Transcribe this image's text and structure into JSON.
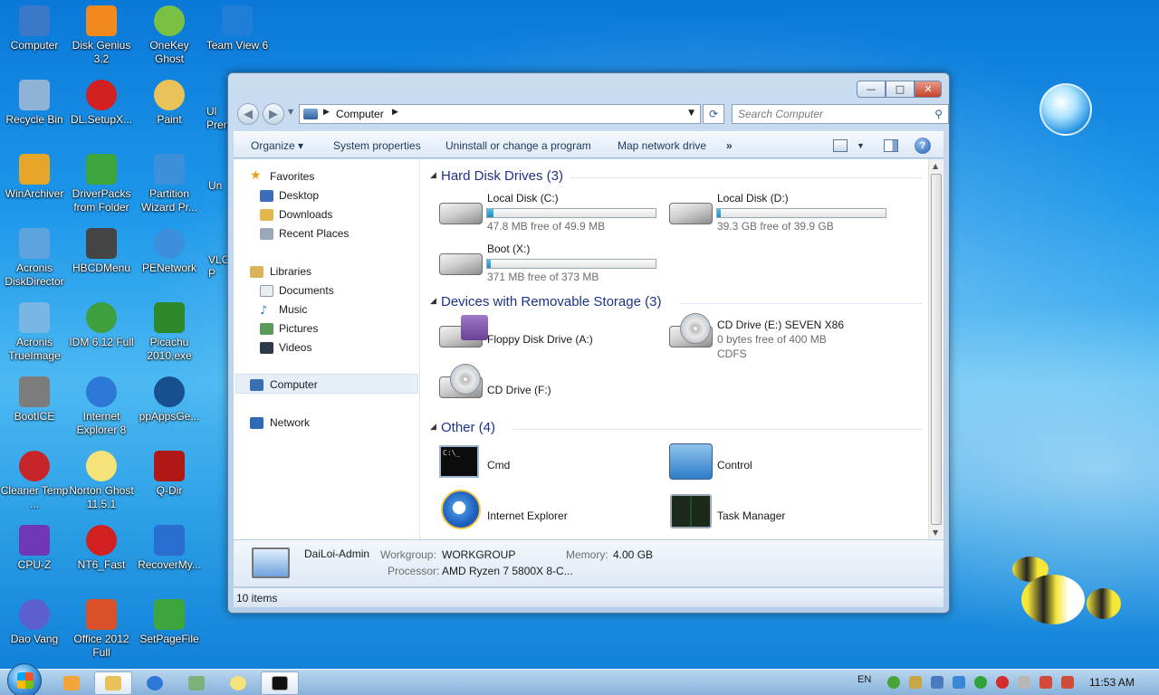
{
  "desktop": {
    "icons": [
      {
        "label": "Computer",
        "color": "#3a78c8"
      },
      {
        "label": "Disk Genius 3.2",
        "color": "#f08a1c"
      },
      {
        "label": "OneKey Ghost",
        "color": "#7ac043"
      },
      {
        "label": "Team View 6",
        "color": "#1f7fd6"
      },
      {
        "label": "Recycle Bin",
        "color": "#8fb3d6"
      },
      {
        "label": "DL.SetupX...",
        "color": "#d21f1f"
      },
      {
        "label": "Paint",
        "color": "#e9c25a"
      },
      {
        "label": "WinArchiver",
        "color": "#e6a629"
      },
      {
        "label": "DriverPacks from Folder",
        "color": "#3da53b"
      },
      {
        "label": "Partition Wizard Pr...",
        "color": "#3c8fd8"
      },
      {
        "label": "Acronis DiskDirector",
        "color": "#5da4df"
      },
      {
        "label": "HBCDMenu",
        "color": "#444444"
      },
      {
        "label": "PENetwork",
        "color": "#3d8edb"
      },
      {
        "label": "Acronis TrueImage",
        "color": "#79b6e6"
      },
      {
        "label": "IDM 6.12 Full",
        "color": "#3da03c"
      },
      {
        "label": "Picachu 2010.exe",
        "color": "#2c8a2c"
      },
      {
        "label": "BootICE",
        "color": "#7c7c7c"
      },
      {
        "label": "Internet Explorer 8",
        "color": "#2d78d6"
      },
      {
        "label": "ppAppsGe...",
        "color": "#17508f"
      },
      {
        "label": "Cleaner Temp ...",
        "color": "#c6262a"
      },
      {
        "label": "Norton Ghost 11.5.1",
        "color": "#f6e27a"
      },
      {
        "label": "Q-Dir",
        "color": "#b01818"
      },
      {
        "label": "CPU-Z",
        "color": "#7038b8"
      },
      {
        "label": "NT6_Fast",
        "color": "#d21f1f"
      },
      {
        "label": "RecoverMy...",
        "color": "#2a6fd0"
      },
      {
        "label": "Dao Vang",
        "color": "#5d5fcf"
      },
      {
        "label": "Office 2012 Full",
        "color": "#d8512a"
      },
      {
        "label": "SetPageFile",
        "color": "#3da53b"
      }
    ],
    "partial_labels": [
      "Ul",
      "Pren",
      "Un",
      "VLC",
      "P"
    ]
  },
  "window": {
    "controls": {
      "minimize": "—",
      "maximize": "□",
      "close": "✕"
    },
    "address": {
      "location": "Computer",
      "icon": "computer-icon"
    },
    "search": {
      "placeholder": "Search Computer"
    },
    "toolbar": {
      "organize": "Organize ▾",
      "system_properties": "System properties",
      "uninstall": "Uninstall or change a program",
      "map_drive": "Map network drive",
      "more": "»"
    },
    "nav": {
      "favorites": "Favorites",
      "desktop": "Desktop",
      "downloads": "Downloads",
      "recent": "Recent Places",
      "libraries": "Libraries",
      "documents": "Documents",
      "music": "Music",
      "pictures": "Pictures",
      "videos": "Videos",
      "computer": "Computer",
      "network": "Network"
    },
    "groups": {
      "hdd": "Hard Disk Drives (3)",
      "removable": "Devices with Removable Storage (3)",
      "other": "Other (4)"
    },
    "drives": {
      "c": {
        "name": "Local Disk (C:)",
        "free": "47.8 MB free of 49.9 MB",
        "used_fraction": 0.04
      },
      "d": {
        "name": "Local Disk (D:)",
        "free": "39.3 GB free of 39.9 GB",
        "used_fraction": 0.015
      },
      "x": {
        "name": "Boot (X:)",
        "free": "371 MB free of 373 MB",
        "used_fraction": 0.005
      }
    },
    "removable": {
      "floppy": "Floppy Disk Drive (A:)",
      "cd_e": {
        "name": "CD Drive (E:) SEVEN X86",
        "free": "0 bytes free of 400 MB",
        "fs": "CDFS"
      },
      "cd_f": "CD Drive (F:)"
    },
    "other": {
      "cmd": "Cmd",
      "control": "Control",
      "ie": "Internet Explorer",
      "taskmgr": "Task Manager"
    },
    "details": {
      "name": "DaiLoi-Admin",
      "workgroup_label": "Workgroup:",
      "workgroup": "WORKGROUP",
      "memory_label": "Memory:",
      "memory": "4.00 GB",
      "processor_label": "Processor:",
      "processor": "AMD Ryzen 7 5800X 8-C..."
    },
    "status": "10 items"
  },
  "taskbar": {
    "lang": "EN",
    "clock": "11:53 AM"
  },
  "colors": {
    "group_heading": "#1e3287",
    "bar_fill": "#26a0da",
    "taskbar": "#a7c8e8"
  }
}
